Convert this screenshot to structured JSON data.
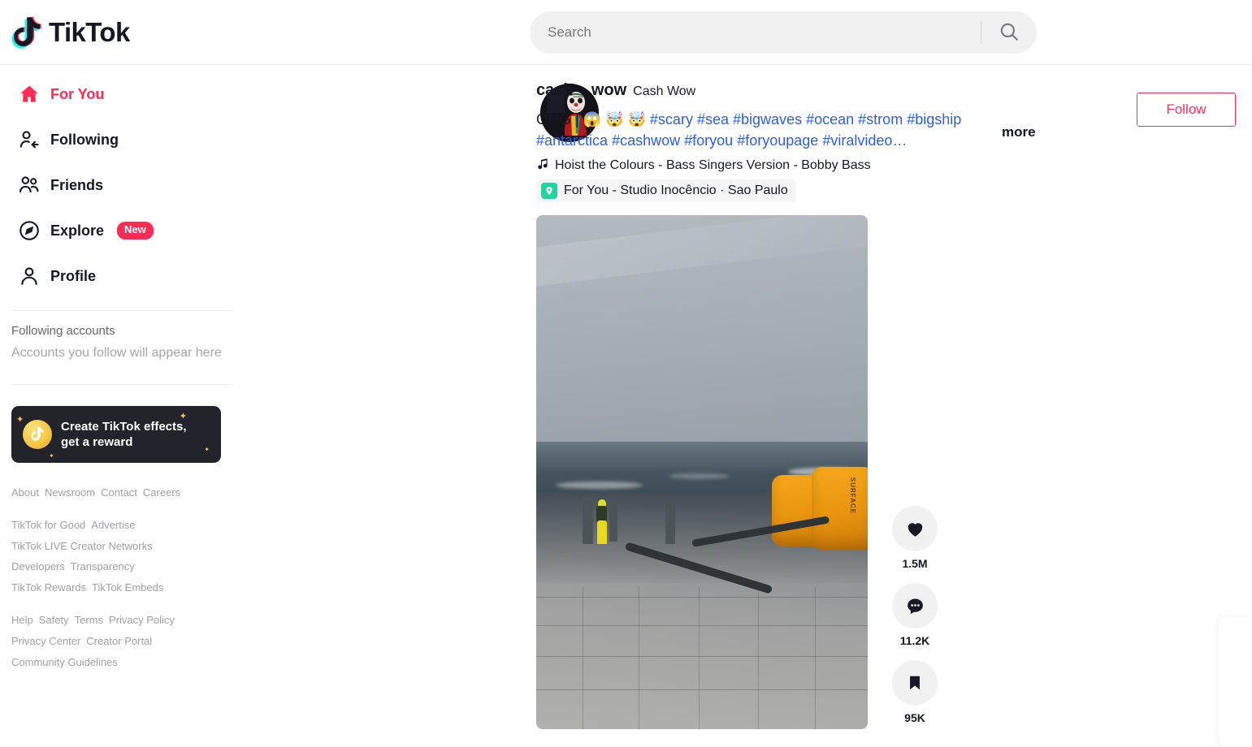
{
  "header": {
    "logo_text": "TikTok",
    "logo_icon": "tiktok-note-icon",
    "search": {
      "placeholder": "Search",
      "value": "",
      "icon": "search-icon"
    }
  },
  "sidebar": {
    "nav": [
      {
        "label": "For You",
        "icon": "home-icon",
        "active": true,
        "badge": ""
      },
      {
        "label": "Following",
        "icon": "user-follow-icon",
        "active": false,
        "badge": ""
      },
      {
        "label": "Friends",
        "icon": "users-icon",
        "active": false,
        "badge": ""
      },
      {
        "label": "Explore",
        "icon": "compass-icon",
        "active": false,
        "badge": "New"
      },
      {
        "label": "Profile",
        "icon": "user-icon",
        "active": false,
        "badge": ""
      }
    ],
    "following": {
      "heading": "Following accounts",
      "empty_text": "Accounts you follow will appear here"
    },
    "promo": {
      "line1": "Create TikTok effects,",
      "line2": "get a reward",
      "icon": "tiktok-coin-icon"
    },
    "footer_groups": [
      [
        "About",
        "Newsroom",
        "Contact",
        "Careers"
      ],
      [
        "TikTok for Good",
        "Advertise",
        "TikTok LIVE Creator Networks",
        "Developers",
        "Transparency",
        "TikTok Rewards",
        "TikTok Embeds"
      ],
      [
        "Help",
        "Safety",
        "Terms",
        "Privacy Policy",
        "Privacy Center",
        "Creator Portal",
        "Community Guidelines"
      ]
    ]
  },
  "post": {
    "username": "cash__wow",
    "nickname": "Cash Wow",
    "caption_prefix": "OMG | 😱 🤯 🤯 ",
    "hashtags": [
      "#scary",
      "#sea",
      "#bigwaves",
      "#ocean",
      "#strom",
      "#bigship",
      "#antarctica",
      "#cashwow",
      "#foryou",
      "#foryoupage",
      "#viralvideo…"
    ],
    "more_label": "more",
    "music": {
      "icon": "music-note-icon",
      "title": "Hoist the Colours - Bass Singers Version - Bobby Bass"
    },
    "location": {
      "icon": "location-pin-icon",
      "text": "For You - Studio Inocêncio · Sao Paulo"
    },
    "follow_button": "Follow",
    "actions": [
      {
        "name": "like",
        "icon": "heart-icon",
        "count": "1.5M"
      },
      {
        "name": "comment",
        "icon": "comment-icon",
        "count": "11.2K"
      },
      {
        "name": "bookmark",
        "icon": "bookmark-icon",
        "count": "95K"
      }
    ]
  },
  "colors": {
    "brand_red": "#fe2c55",
    "link_blue": "#2b5eea",
    "text_dark": "#161823",
    "muted": "#a0a0a5",
    "chip_bg": "#f1f1f2",
    "pin_green": "#20d5a0"
  }
}
